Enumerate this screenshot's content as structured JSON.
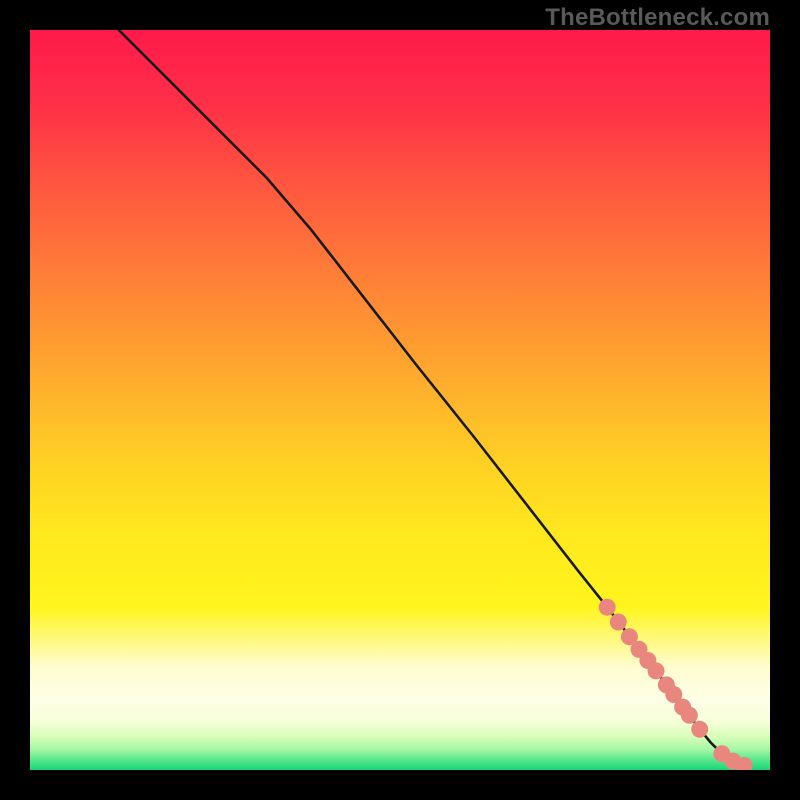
{
  "watermark": "TheBottleneck.com",
  "chart_data": {
    "type": "line",
    "title": "",
    "xlabel": "",
    "ylabel": "",
    "xlim": [
      0,
      100
    ],
    "ylim": [
      0,
      100
    ],
    "series": [
      {
        "name": "curve",
        "x": [
          12,
          32,
          38,
          45,
          52,
          60,
          67,
          74,
          78,
          83,
          86,
          89,
          90.5,
          92,
          93.5,
          95,
          96.5
        ],
        "y": [
          100,
          80,
          73,
          64,
          55,
          45,
          36,
          27,
          22,
          15.5,
          11.5,
          7.5,
          5.5,
          3.7,
          2.2,
          1.2,
          0.6
        ]
      }
    ],
    "markers": {
      "name": "highlighted-points",
      "x": [
        78,
        79.5,
        81,
        82.3,
        83.5,
        84.6,
        86,
        87,
        88.2,
        89.1,
        90.5,
        93.5,
        95,
        96.5
      ],
      "y": [
        22,
        20,
        18,
        16.3,
        14.8,
        13.4,
        11.5,
        10.2,
        8.5,
        7.4,
        5.5,
        2.2,
        1.2,
        0.6
      ]
    },
    "background": {
      "stops": [
        {
          "pos": 0.0,
          "color": "#ff1a4a"
        },
        {
          "pos": 0.1,
          "color": "#ff2f47"
        },
        {
          "pos": 0.22,
          "color": "#ff5a3f"
        },
        {
          "pos": 0.35,
          "color": "#ff8436"
        },
        {
          "pos": 0.48,
          "color": "#ffae2d"
        },
        {
          "pos": 0.58,
          "color": "#ffcf24"
        },
        {
          "pos": 0.68,
          "color": "#ffe81e"
        },
        {
          "pos": 0.78,
          "color": "#fff51d"
        },
        {
          "pos": 0.86,
          "color": "#fffccf"
        },
        {
          "pos": 0.905,
          "color": "#ffffe8"
        },
        {
          "pos": 0.935,
          "color": "#f6ffd9"
        },
        {
          "pos": 0.955,
          "color": "#d8feb8"
        },
        {
          "pos": 0.972,
          "color": "#a6f8a6"
        },
        {
          "pos": 0.985,
          "color": "#5ee88f"
        },
        {
          "pos": 1.0,
          "color": "#17d776"
        }
      ]
    },
    "marker_color": "#e9877e",
    "line_color": "#1a1a1a"
  }
}
